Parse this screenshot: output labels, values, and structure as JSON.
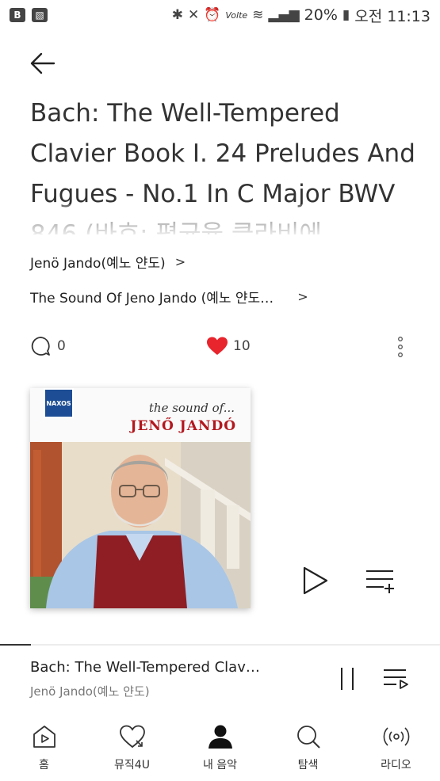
{
  "status_bar": {
    "battery": "20%",
    "time": "오전 11:13",
    "network": "Volte"
  },
  "track": {
    "title": "Bach: The Well-Tempered Clavier Book I. 24 Preludes And Fugues - No.1 In C Major BWV 846 (바흐: 평균율 클라비에",
    "artist": "Jenö Jando(예노 얀도)",
    "album": "The Sound Of Jeno Jando (예노 얀도…"
  },
  "social": {
    "comment_count": "0",
    "like_count": "10"
  },
  "album_art": {
    "label": "NAXOS",
    "subtitle": "the sound of...",
    "name": "JENŐ JANDÓ"
  },
  "mini_player": {
    "title": "Bach: The Well-Tempered Clav…",
    "artist": "Jenö Jando(예노 얀도)",
    "progress": 0.07
  },
  "nav": {
    "items": [
      {
        "label": "홈",
        "icon": "home-icon"
      },
      {
        "label": "뮤직4U",
        "icon": "heart-icon"
      },
      {
        "label": "내 음악",
        "icon": "person-icon"
      },
      {
        "label": "탐색",
        "icon": "search-icon"
      },
      {
        "label": "라디오",
        "icon": "radio-icon"
      }
    ]
  },
  "colors": {
    "like": "#e8242d",
    "accent_dark": "#222222"
  }
}
